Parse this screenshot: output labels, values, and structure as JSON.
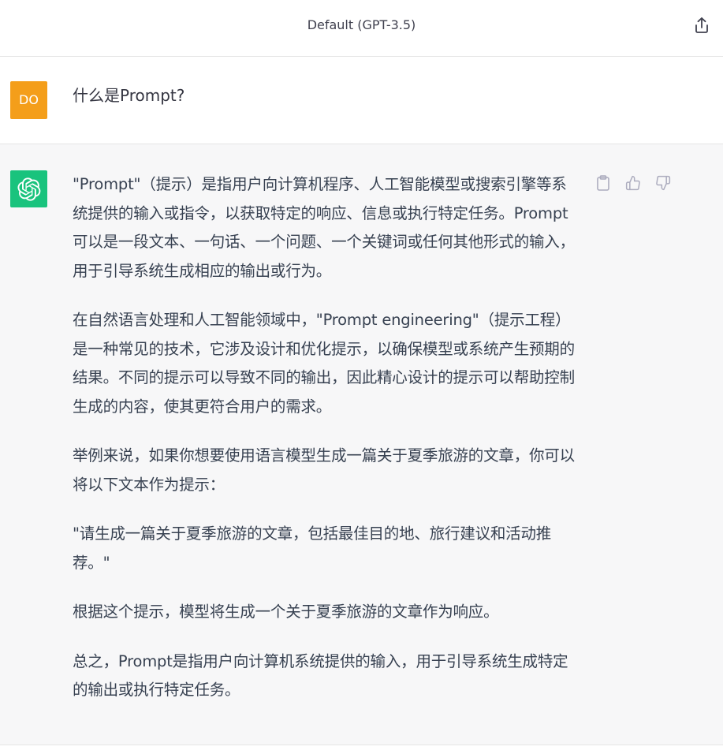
{
  "header": {
    "title": "Default (GPT-3.5)",
    "share_icon": "share-icon"
  },
  "user_message": {
    "avatar_initials": "DO",
    "avatar_color": "#f49e1a",
    "text": "什么是Prompt?"
  },
  "assistant_message": {
    "avatar_icon": "openai-logo-icon",
    "avatar_color": "#19c37d",
    "paragraphs": [
      "\"Prompt\"（提示）是指用户向计算机程序、人工智能模型或搜索引擎等系统提供的输入或指令，以获取特定的响应、信息或执行特定任务。Prompt可以是一段文本、一句话、一个问题、一个关键词或任何其他形式的输入，用于引导系统生成相应的输出或行为。",
      "在自然语言处理和人工智能领域中，\"Prompt engineering\"（提示工程）是一种常见的技术，它涉及设计和优化提示，以确保模型或系统产生预期的结果。不同的提示可以导致不同的输出，因此精心设计的提示可以帮助控制生成的内容，使其更符合用户的需求。",
      "举例来说，如果你想要使用语言模型生成一篇关于夏季旅游的文章，你可以将以下文本作为提示：",
      "\"请生成一篇关于夏季旅游的文章，包括最佳目的地、旅行建议和活动推荐。\"",
      "根据这个提示，模型将生成一个关于夏季旅游的文章作为响应。",
      "总之，Prompt是指用户向计算机系统提供的输入，用于引导系统生成特定的输出或执行特定任务。"
    ],
    "actions": [
      "clipboard-icon",
      "thumbs-up-icon",
      "thumbs-down-icon"
    ]
  }
}
